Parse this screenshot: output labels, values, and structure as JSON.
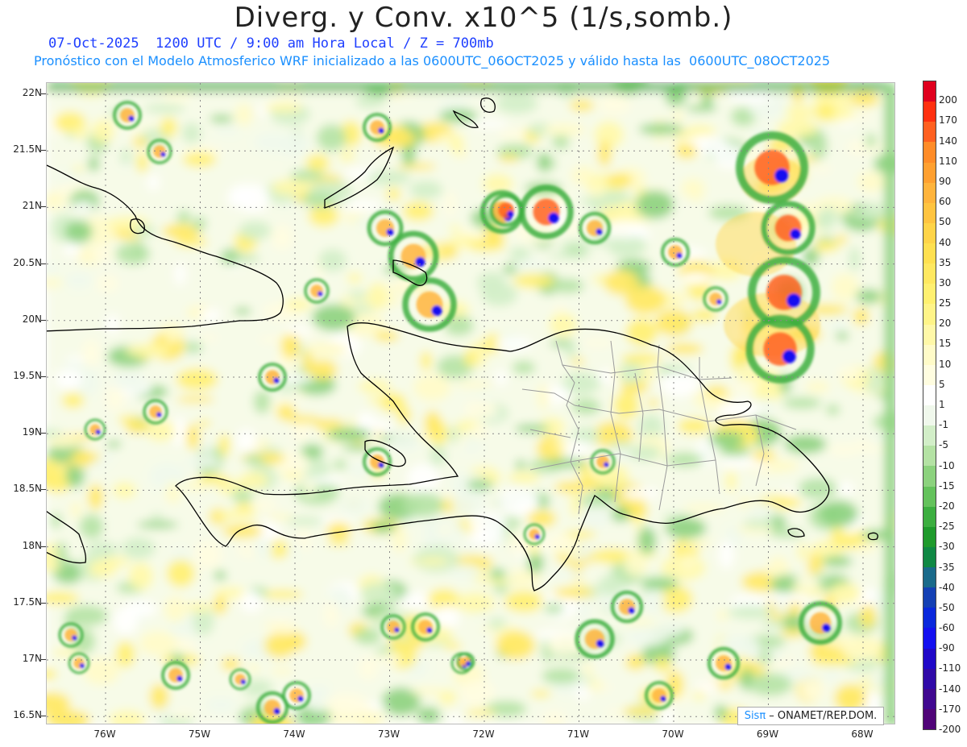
{
  "title": "Diverg. y Conv. x10^5 (1/s,somb.)",
  "subtitle_line1": "07-Oct-2025  1200 UTC / 9:00 am Hora Local / Z = 700mb",
  "subtitle_line2": "Pronóstico con el Modelo Atmosferico WRF inicializado a las 0600UTC_06OCT2025 y válido hasta las  0600UTC_08OCT2025",
  "credit": {
    "brand": "Sisπ",
    "rest": " – ONAMET/REP.DOM."
  },
  "axes": {
    "lat_labels": [
      "22N",
      "21.5N",
      "21N",
      "20.5N",
      "20N",
      "19.5N",
      "19N",
      "18.5N",
      "18N",
      "17.5N",
      "17N",
      "16.5N"
    ],
    "lon_labels": [
      "76W",
      "75W",
      "74W",
      "73W",
      "72W",
      "71W",
      "70W",
      "69W",
      "68W"
    ],
    "lat_range": [
      16.45,
      22.1
    ],
    "lon_range": [
      76.6,
      67.6
    ]
  },
  "colorbar": {
    "labels": [
      "200",
      "170",
      "140",
      "110",
      "90",
      "60",
      "50",
      "40",
      "35",
      "30",
      "25",
      "20",
      "15",
      "10",
      "5",
      "1",
      "-1",
      "-5",
      "-10",
      "-15",
      "-20",
      "-25",
      "-30",
      "-35",
      "-40",
      "-50",
      "-60",
      "-90",
      "-110",
      "-140",
      "-170",
      "-200"
    ],
    "colors": [
      "#e0001e",
      "#ff3010",
      "#ff6020",
      "#ff8c28",
      "#ffa030",
      "#ffb43c",
      "#ffc440",
      "#ffd448",
      "#ffe050",
      "#ffe860",
      "#fff070",
      "#fff488",
      "#fff8a8",
      "#fffbc8",
      "#fffde0",
      "#ffffff",
      "#f0f8ec",
      "#d2eec8",
      "#b4e2a4",
      "#8cd27e",
      "#64c25c",
      "#3cae40",
      "#1f9a2c",
      "#108844",
      "#1a6a8a",
      "#1440b4",
      "#0a28dc",
      "#1410f0",
      "#2008c8",
      "#300aa8",
      "#400890",
      "#500478"
    ]
  }
}
